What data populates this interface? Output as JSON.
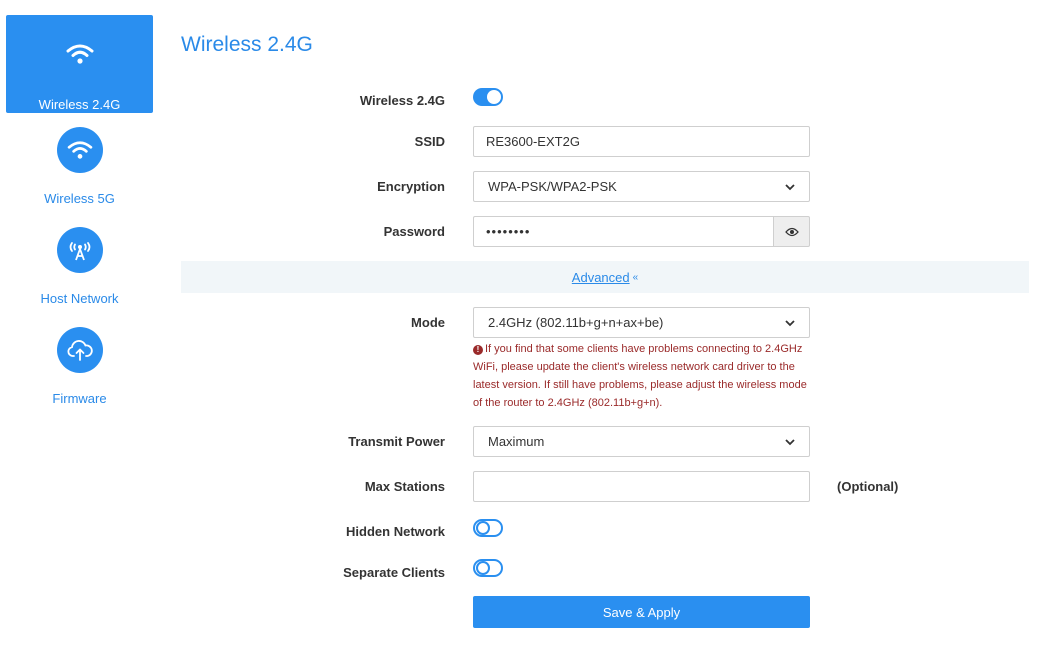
{
  "sidebar": {
    "items": [
      {
        "label": "Wireless 2.4G",
        "icon": "wifi-icon",
        "active": true
      },
      {
        "label": "Wireless 5G",
        "icon": "wifi-icon",
        "active": false
      },
      {
        "label": "Host Network",
        "icon": "antenna-icon",
        "active": false
      },
      {
        "label": "Firmware",
        "icon": "cloud-upload-icon",
        "active": false
      }
    ]
  },
  "page": {
    "title": "Wireless 2.4G"
  },
  "form": {
    "wireless_label": "Wireless 2.4G",
    "wireless_enabled": true,
    "ssid_label": "SSID",
    "ssid_value": "RE3600-EXT2G",
    "encryption_label": "Encryption",
    "encryption_value": "WPA-PSK/WPA2-PSK",
    "password_label": "Password",
    "password_value": "••••••••",
    "advanced_label": "Advanced",
    "mode_label": "Mode",
    "mode_value": "2.4GHz (802.11b+g+n+ax+be)",
    "mode_warning": "If you find that some clients have problems connecting to 2.4GHz WiFi, please update the client's wireless network card driver to the latest version. If still have problems, please adjust the wireless mode of the router to 2.4GHz (802.11b+g+n).",
    "transmit_power_label": "Transmit Power",
    "transmit_power_value": "Maximum",
    "max_stations_label": "Max Stations",
    "max_stations_value": "",
    "optional_label": "(Optional)",
    "hidden_network_label": "Hidden Network",
    "hidden_network_enabled": false,
    "separate_clients_label": "Separate Clients",
    "separate_clients_enabled": false,
    "apply_label": "Save & Apply"
  },
  "colors": {
    "accent": "#2a8ff0",
    "warning": "#9a2a2a",
    "advanced_bg": "#f1f6f9"
  }
}
